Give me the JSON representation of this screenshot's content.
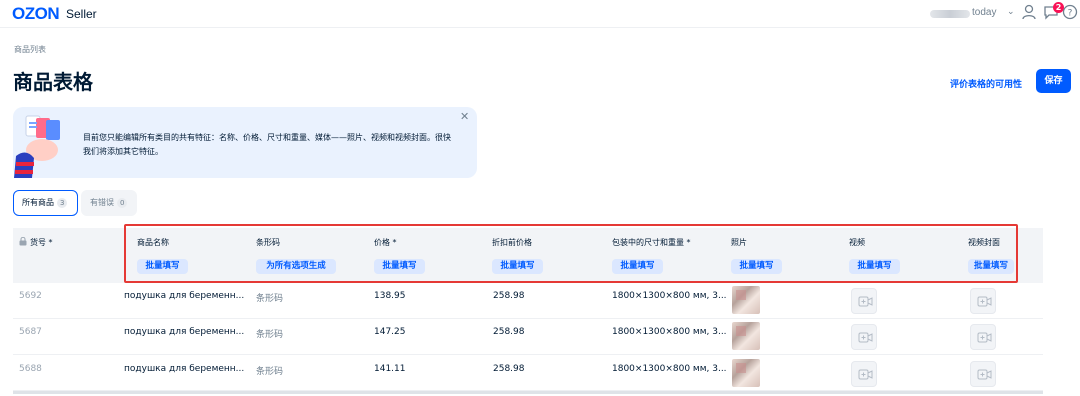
{
  "topbar": {
    "logo": "OZON",
    "logo_suffix": "Seller",
    "account_label": "today",
    "notification_count": "2"
  },
  "header": {
    "breadcrumb": "商品列表",
    "title": "商品表格",
    "rate_link": "评价表格的可用性",
    "save_label": "保存"
  },
  "banner": {
    "text": "目前您只能编辑所有类目的共有特征：名称、价格、尺寸和重量、媒体——照片、视频和视频封面。很快我们将添加其它特征。"
  },
  "tabs": [
    {
      "label": "所有商品",
      "count": "3"
    },
    {
      "label": "有错误",
      "count": "0"
    }
  ],
  "table": {
    "columns": {
      "sku": "货号 *",
      "name": "商品名称",
      "barcode": "条形码",
      "price": "价格 *",
      "old_price": "折扣前价格",
      "dimensions": "包装中的尺寸和重量 *",
      "photo": "照片",
      "video": "视频",
      "video_cover": "视频封面"
    },
    "bulk": {
      "name": "批量填写",
      "barcode": "为所有选项生成",
      "price": "批量填写",
      "old_price": "批量填写",
      "dimensions": "批量填写",
      "photo": "批量填写",
      "video": "批量填写",
      "video_cover": "批量填写"
    },
    "rows": [
      {
        "sku": "5692",
        "name": "подушка для беременн...",
        "barcode": "条形码",
        "price": "138.95",
        "old_price": "258.98",
        "dimensions": "1800×1300×800 мм, 3..."
      },
      {
        "sku": "5687",
        "name": "подушка для беременн...",
        "barcode": "条形码",
        "price": "147.25",
        "old_price": "258.98",
        "dimensions": "1800×1300×800 мм, 3..."
      },
      {
        "sku": "5688",
        "name": "подушка для беременн...",
        "barcode": "条形码",
        "price": "141.11",
        "old_price": "258.98",
        "dimensions": "1800×1300×800 мм, 3..."
      }
    ]
  },
  "colors": {
    "accent": "#005bff",
    "highlight": "#e53935",
    "badge": "#f91155"
  },
  "icons": [
    "user-icon",
    "chat-icon",
    "help-icon",
    "lock-icon",
    "close-icon",
    "video-placeholder-icon"
  ]
}
